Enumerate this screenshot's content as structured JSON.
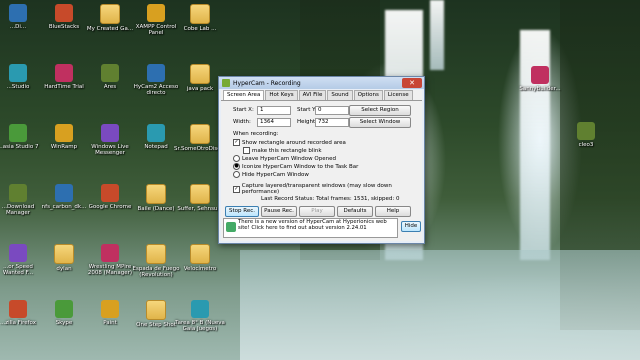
{
  "desktop_icons": [
    {
      "label": "...Di...",
      "kind": "app"
    },
    {
      "label": "BlueStacks",
      "kind": "app"
    },
    {
      "label": "My Created Ga...",
      "kind": "folder"
    },
    {
      "label": "XAMPP Control Panel",
      "kind": "app"
    },
    {
      "label": "Cobe Lab ...",
      "kind": "folder"
    },
    {
      "label": "...Studio",
      "kind": "app"
    },
    {
      "label": "HardTime Trial",
      "kind": "app"
    },
    {
      "label": "Ares",
      "kind": "app"
    },
    {
      "label": "HyCam2 Acceso directo",
      "kind": "app"
    },
    {
      "label": "java pack",
      "kind": "folder"
    },
    {
      "label": "...asia Studio 7",
      "kind": "app"
    },
    {
      "label": "WinRamp",
      "kind": "app"
    },
    {
      "label": "Windows Live Messenger",
      "kind": "app"
    },
    {
      "label": "Notepad",
      "kind": "app"
    },
    {
      "label": "Sr.SomeOtroDiseño",
      "kind": "folder"
    },
    {
      "label": "...Download Manager",
      "kind": "app"
    },
    {
      "label": "nfs_carbon_dk...",
      "kind": "app"
    },
    {
      "label": "Google Chrome",
      "kind": "app"
    },
    {
      "label": "Baile (Dance)",
      "kind": "folder"
    },
    {
      "label": "Suffer, Sehnsu...",
      "kind": "folder"
    },
    {
      "label": "...or Speed Wanted F...",
      "kind": "app"
    },
    {
      "label": "dylan",
      "kind": "folder"
    },
    {
      "label": "Wrestling MPire 2008 (Manager)",
      "kind": "app"
    },
    {
      "label": "Espada de Fuego (Revolution)",
      "kind": "folder"
    },
    {
      "label": "Velocímetro",
      "kind": "folder"
    },
    {
      "label": "...zilla Firefox",
      "kind": "app"
    },
    {
      "label": "Skype",
      "kind": "app"
    },
    {
      "label": "Paint",
      "kind": "app"
    },
    {
      "label": "One Step Shot",
      "kind": "folder"
    },
    {
      "label": "Tarea 8° B (Nueva Gaia Juegos)",
      "kind": "app"
    },
    {
      "label": "SannyBuilder...",
      "kind": "app"
    },
    {
      "label": "cleo3",
      "kind": "app"
    }
  ],
  "window": {
    "title": "HyperCam - Recording",
    "tabs": [
      "Screen Area",
      "Hot Keys",
      "AVI File",
      "Sound",
      "Options",
      "License"
    ],
    "startx_label": "Start X:",
    "startx_value": "1",
    "starty_label": "Start Y:",
    "starty_value": "0",
    "width_label": "Width:",
    "width_value": "1364",
    "height_label": "Height:",
    "height_value": "732",
    "select_region": "Select Region",
    "select_window": "Select Window",
    "when_recording": "When recording:",
    "opt_show_rect": "Show rectangle around recorded area",
    "opt_blink": "make this rectangle blink",
    "opt_leave": "Leave HyperCam Window Opened",
    "opt_iconize": "Iconize HyperCam Window to the Task Bar",
    "opt_hide": "Hide HyperCam Window",
    "opt_capture_layered": "Capture layered/transparent windows (may slow down performance)",
    "status": "Last Record Status: Total frames: 1531, skipped: 0",
    "btn_stop": "Stop Rec.",
    "btn_pause": "Pause Rec.",
    "btn_play": "Play",
    "btn_defaults": "Defaults",
    "btn_help": "Help",
    "notice": "There is a new version of HyperCam at Hyperionics web site! Click here to find out about version 2.24.01",
    "btn_hide": "Hide"
  }
}
